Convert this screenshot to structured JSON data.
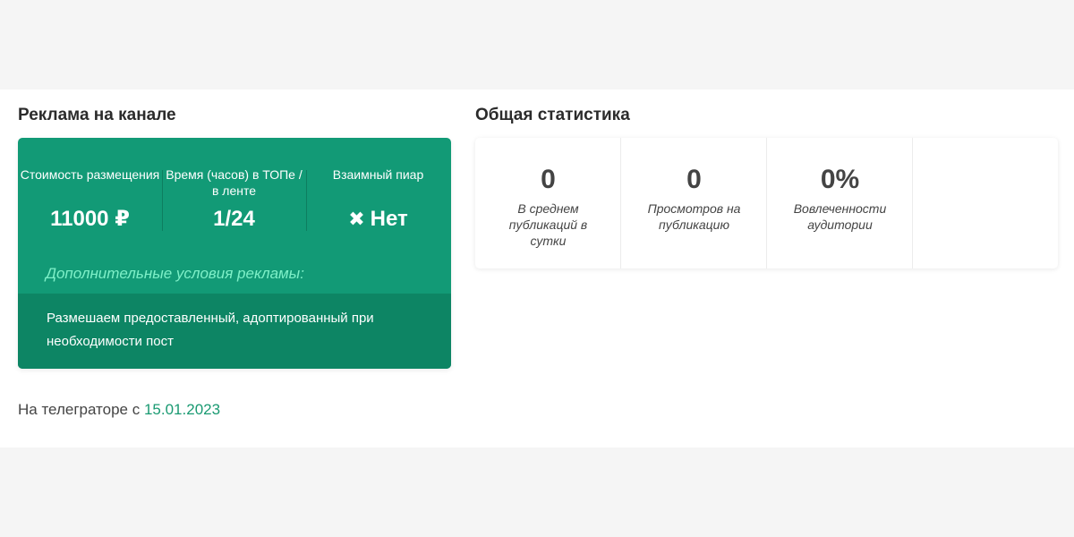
{
  "ad_section": {
    "title": "Реклама на канале",
    "price_label": "Стоимость размещения",
    "price_value": "11000 ₽",
    "time_label": "Время (часов) в ТОПе / в ленте",
    "time_value": "1/24",
    "mutual_label": "Взаимный пиар",
    "mutual_value": "Нет",
    "mutual_icon": "close-icon",
    "extra_title": "Дополнительные условия рекламы:",
    "extra_text": "Размешаем предоставленный, адоптированный при необходимости пост",
    "colors": {
      "card": "#129a76",
      "card_dark": "#0d8564",
      "extra_title": "#7ef0c8"
    }
  },
  "since": {
    "prefix": "На телеграторе с",
    "date": "15.01.2023",
    "date_color": "#1a9a72"
  },
  "stats_section": {
    "title": "Общая статистика",
    "items": [
      {
        "value": "0",
        "label": "В среднем публикаций в сутки"
      },
      {
        "value": "0",
        "label": "Просмотров на публикацию"
      },
      {
        "value": "0%",
        "label": "Вовлеченности аудитории"
      }
    ]
  }
}
